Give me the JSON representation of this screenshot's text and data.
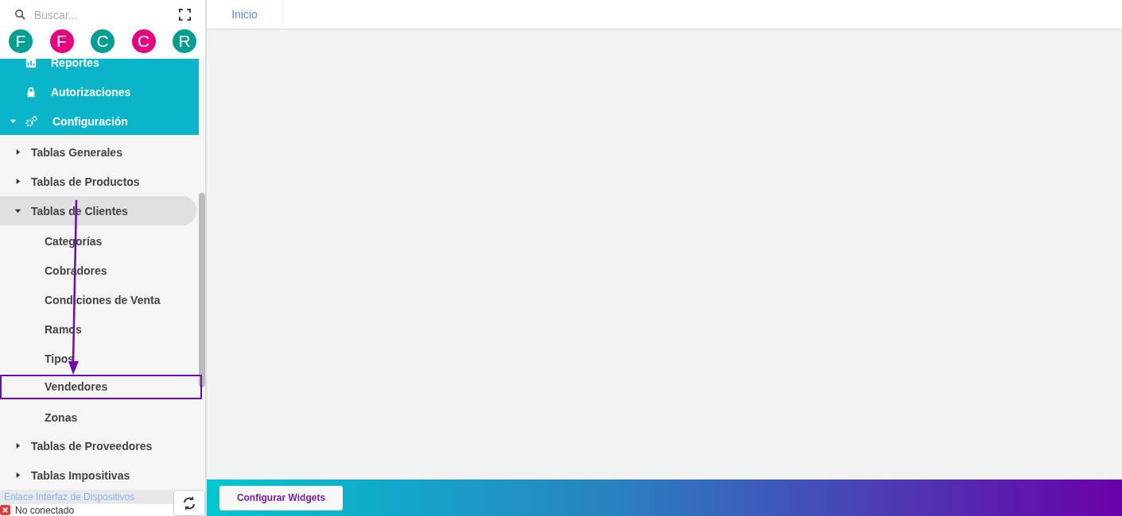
{
  "search": {
    "placeholder": "Buscar..."
  },
  "avatars": [
    {
      "letter": "F",
      "color": "#009e93"
    },
    {
      "letter": "F",
      "color": "#e6007e"
    },
    {
      "letter": "C",
      "color": "#009e93"
    },
    {
      "letter": "C",
      "color": "#e6007e"
    },
    {
      "letter": "R",
      "color": "#009e93"
    }
  ],
  "menu": [
    {
      "label": "Reportes",
      "kind": "chart",
      "expanded": false
    },
    {
      "label": "Autorizaciones",
      "kind": "lock",
      "expanded": false
    },
    {
      "label": "Configuración",
      "kind": "gears",
      "expanded": true
    }
  ],
  "tree": [
    {
      "label": "Tablas Generales",
      "expanded": false,
      "selected": false
    },
    {
      "label": "Tablas de Productos",
      "expanded": false,
      "selected": false
    },
    {
      "label": "Tablas de Clientes",
      "expanded": true,
      "selected": true,
      "children": [
        {
          "label": "Categorías",
          "highlighted": false
        },
        {
          "label": "Cobradores",
          "highlighted": false
        },
        {
          "label": "Condiciones de Venta",
          "highlighted": false
        },
        {
          "label": "Ramos",
          "highlighted": false
        },
        {
          "label": "Tipos",
          "highlighted": false
        },
        {
          "label": "Vendedores",
          "highlighted": true
        },
        {
          "label": "Zonas",
          "highlighted": false
        }
      ]
    },
    {
      "label": "Tablas de Proveedores",
      "expanded": false,
      "selected": false
    },
    {
      "label": "Tablas Impositivas",
      "expanded": false,
      "selected": false
    }
  ],
  "device_link": {
    "label": "Enlace Interfaz de Dispositivos",
    "status": "No conectado",
    "connected": false
  },
  "tabs": [
    {
      "label": "Inicio",
      "selected": true
    }
  ],
  "footer": {
    "button": "Configurar Widgets"
  }
}
